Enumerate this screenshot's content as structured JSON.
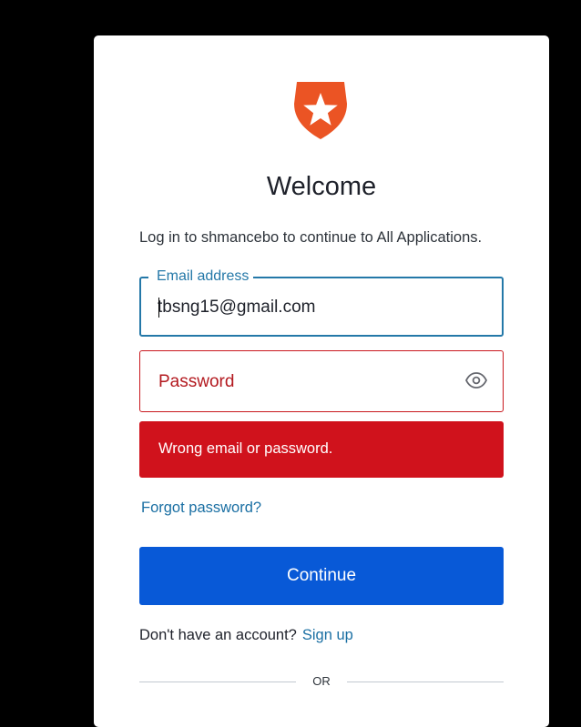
{
  "brand": {
    "logo_icon": "auth0-shield-star-icon",
    "logo_color": "#eb5424"
  },
  "login": {
    "title": "Welcome",
    "subtitle": "Log in to shmancebo to continue to All Applications.",
    "email_label": "Email address",
    "email_value": "tbsng15@gmail.com",
    "password_placeholder": "Password",
    "show_password_icon": "eye-icon",
    "error_message": "Wrong email or password.",
    "forgot_password": "Forgot password?",
    "continue_label": "Continue",
    "signup_prompt": "Don't have an account?",
    "signup_link": "Sign up",
    "divider_text": "OR"
  },
  "colors": {
    "accent": "#2478a8",
    "error": "#d0121c",
    "primary_button": "#0859d7",
    "link": "#1a6fa3"
  }
}
